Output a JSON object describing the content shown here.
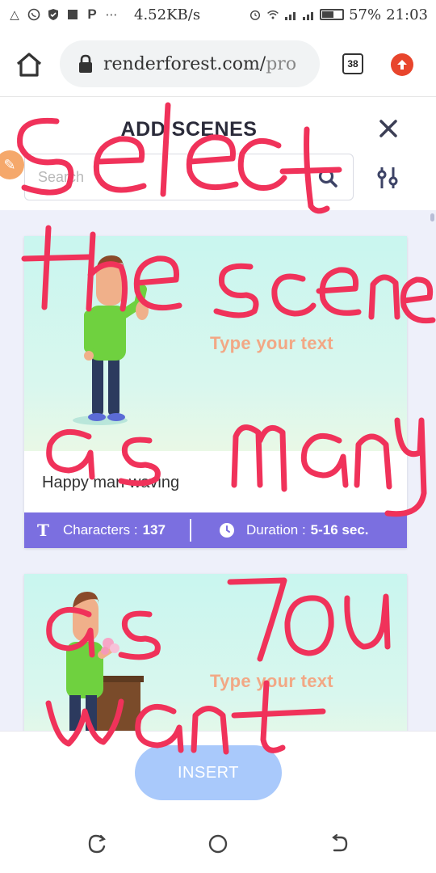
{
  "status_bar": {
    "speed": "4.52KB/s",
    "battery": "57%",
    "battery_level": 0.57,
    "time": "21:03"
  },
  "browser": {
    "url_main": "renderforest.com/",
    "url_rest": "pro",
    "tab_count": "38"
  },
  "modal": {
    "title": "ADD SCENES",
    "search_placeholder": "Search"
  },
  "scenes": [
    {
      "thumb_text": "Type your text",
      "name": "Happy man waving",
      "characters_label": "Characters :",
      "characters_value": "137",
      "duration_label": "Duration :",
      "duration_value": "5-16 sec."
    },
    {
      "thumb_text": "Type your text"
    }
  ],
  "footer": {
    "insert_label": "INSERT"
  },
  "annotation": {
    "lines": [
      "Select",
      "the scene",
      "as many",
      "as You",
      "want"
    ],
    "color": "#f0325a"
  },
  "colors": {
    "meta_bar": "#7b6fe0",
    "insert_button": "#a9c9fb",
    "content_background": "#eef0fa"
  }
}
